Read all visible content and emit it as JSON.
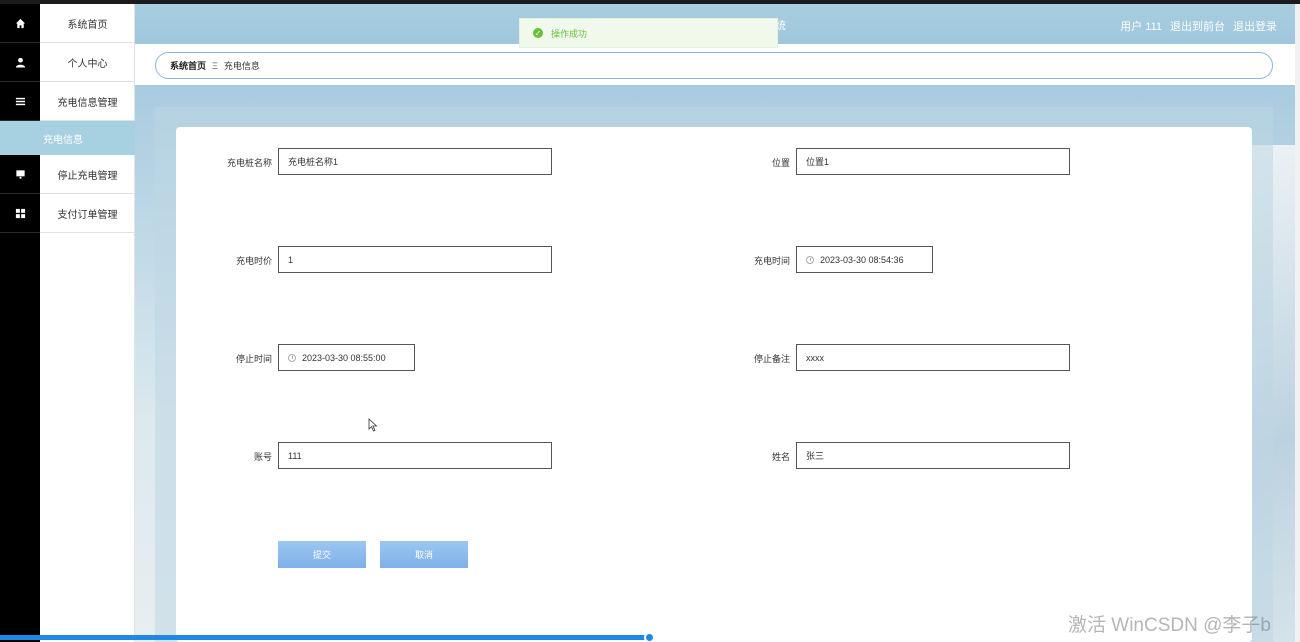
{
  "header": {
    "faded_title": "统",
    "user": "用户 111",
    "to_front": "退出到前台",
    "logout": "退出登录"
  },
  "toast": {
    "message": "操作成功"
  },
  "sidebar": {
    "items": [
      {
        "label": "系统首页",
        "icon": "home-icon"
      },
      {
        "label": "个人中心",
        "icon": "user-icon"
      },
      {
        "label": "充电信息管理",
        "icon": "list-icon"
      },
      {
        "label": "停止充电管理",
        "icon": "monitor-icon"
      },
      {
        "label": "支付订单管理",
        "icon": "grid-icon"
      }
    ],
    "active_sub": "充电信息"
  },
  "breadcrumb": {
    "home": "系统首页",
    "separator": "Ξ",
    "current": "充电信息"
  },
  "form": {
    "pile_name": {
      "label": "充电桩名称",
      "value": "充电桩名称1"
    },
    "location": {
      "label": "位置",
      "value": "位置1"
    },
    "price": {
      "label": "充电时价",
      "value": "1"
    },
    "charge_time": {
      "label": "充电时间",
      "value": "2023-03-30 08:54:36"
    },
    "stop_time": {
      "label": "停止时间",
      "value": "2023-03-30 08:55:00"
    },
    "stop_note": {
      "label": "停止备注",
      "value": "xxxx"
    },
    "account": {
      "label": "账号",
      "value": "111"
    },
    "name": {
      "label": "姓名",
      "value": "张三"
    },
    "submit": "提交",
    "cancel": "取消"
  },
  "watermark": "激活 WinCSDN @李子b",
  "colors": {
    "accent": "#a7d0e1",
    "button": "#8bbbec",
    "success": "#67c23a"
  }
}
